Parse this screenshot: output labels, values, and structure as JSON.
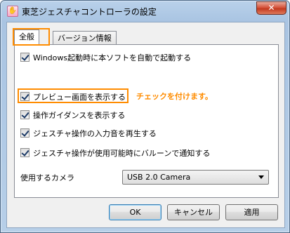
{
  "window": {
    "title": "東芝ジェスチャコントローラの設定",
    "close_label": "✕"
  },
  "tabs": [
    {
      "label": "全般",
      "selected": true
    },
    {
      "label": "バージョン情報",
      "selected": false
    }
  ],
  "options": [
    {
      "label": "Windows起動時に本ソフトを自動で起動する",
      "checked": true
    },
    {
      "label": "プレビュー画面を表示する",
      "checked": true
    },
    {
      "label": "操作ガイダンスを表示する",
      "checked": true
    },
    {
      "label": "ジェスチャ操作の入力音を再生する",
      "checked": true
    },
    {
      "label": "ジェスチャ操作が使用可能時にバルーンで通知する",
      "checked": true
    }
  ],
  "annotation": {
    "text": "チェックを付けます。",
    "color": "#ff8c00"
  },
  "camera": {
    "label": "使用するカメラ",
    "selected": "USB 2.0 Camera"
  },
  "buttons": {
    "ok": "OK",
    "cancel": "キャンセル",
    "apply": "適用"
  }
}
